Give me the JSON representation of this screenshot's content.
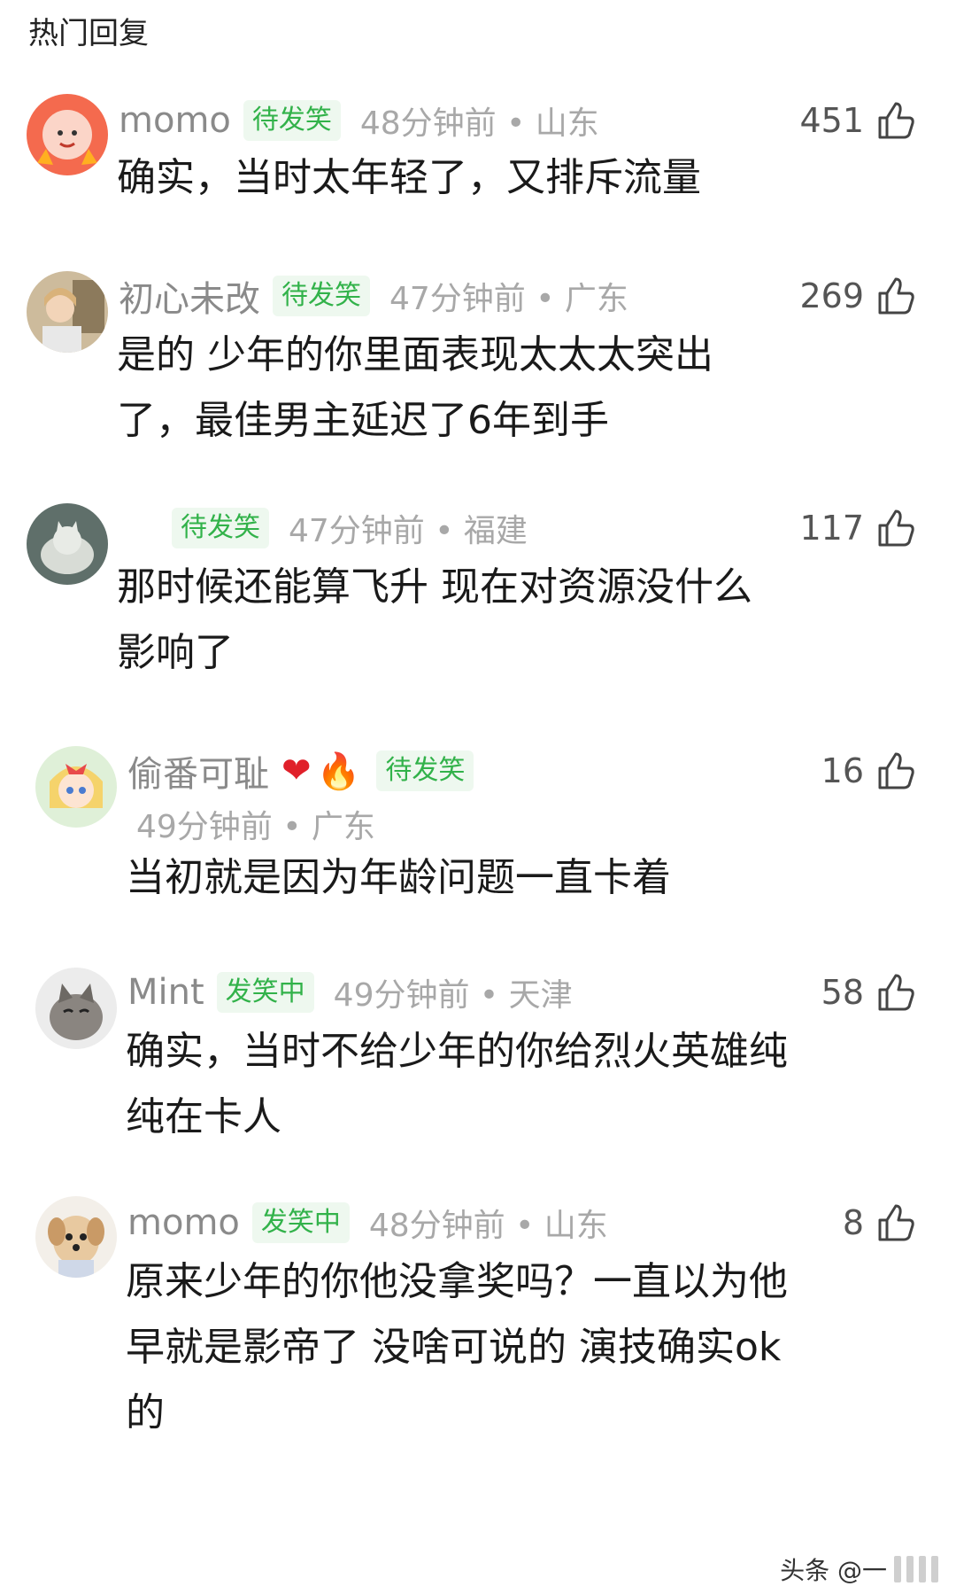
{
  "section_title": "热门回复",
  "comments": [
    {
      "name": "momo",
      "badge": "待发笑",
      "time_location": "48分钟前 • 山东",
      "likes": "451",
      "text": "确实，当时太年轻了，又排斥流量",
      "avatar": "red-cartoon-avatar"
    },
    {
      "name": "初心未改",
      "badge": "待发笑",
      "time_location": "47分钟前 • 广东",
      "likes": "269",
      "text": "是的 少年的你里面表现太太太突出了，最佳男主延迟了6年到手",
      "avatar": "girl-photo-avatar"
    },
    {
      "name": "",
      "badge": "待发笑",
      "time_location": "47分钟前 • 福建",
      "likes": "117",
      "text": "那时候还能算飞升 现在对资源没什么影响了",
      "avatar": "cat-photo-avatar"
    },
    {
      "name": "偷番可耻",
      "name_emoji": [
        "heart-emoji",
        "fire-emoji"
      ],
      "badge": "待发笑",
      "time_location": "49分钟前 • 广东",
      "likes": "16",
      "text": "当初就是因为年龄问题一直卡着",
      "avatar": "anime-girl-avatar"
    },
    {
      "name": "Mint",
      "badge": "发笑中",
      "time_location": "49分钟前 • 天津",
      "likes": "58",
      "text": "确实，当时不给少年的你给烈火英雄纯纯在卡人",
      "avatar": "kitten-photo-avatar"
    },
    {
      "name": "momo",
      "badge": "发笑中",
      "time_location": "48分钟前 • 山东",
      "likes": "8",
      "text": "原来少年的你他没拿奖吗？一直以为他早就是影帝了 没啥可说的 演技确实ok的",
      "avatar": "puppy-photo-avatar"
    }
  ],
  "watermark": "头条 @一",
  "colors": {
    "badge_green": "#32b24a",
    "badge_bg": "#eef8ef",
    "meta_gray": "#a8a8a8"
  }
}
